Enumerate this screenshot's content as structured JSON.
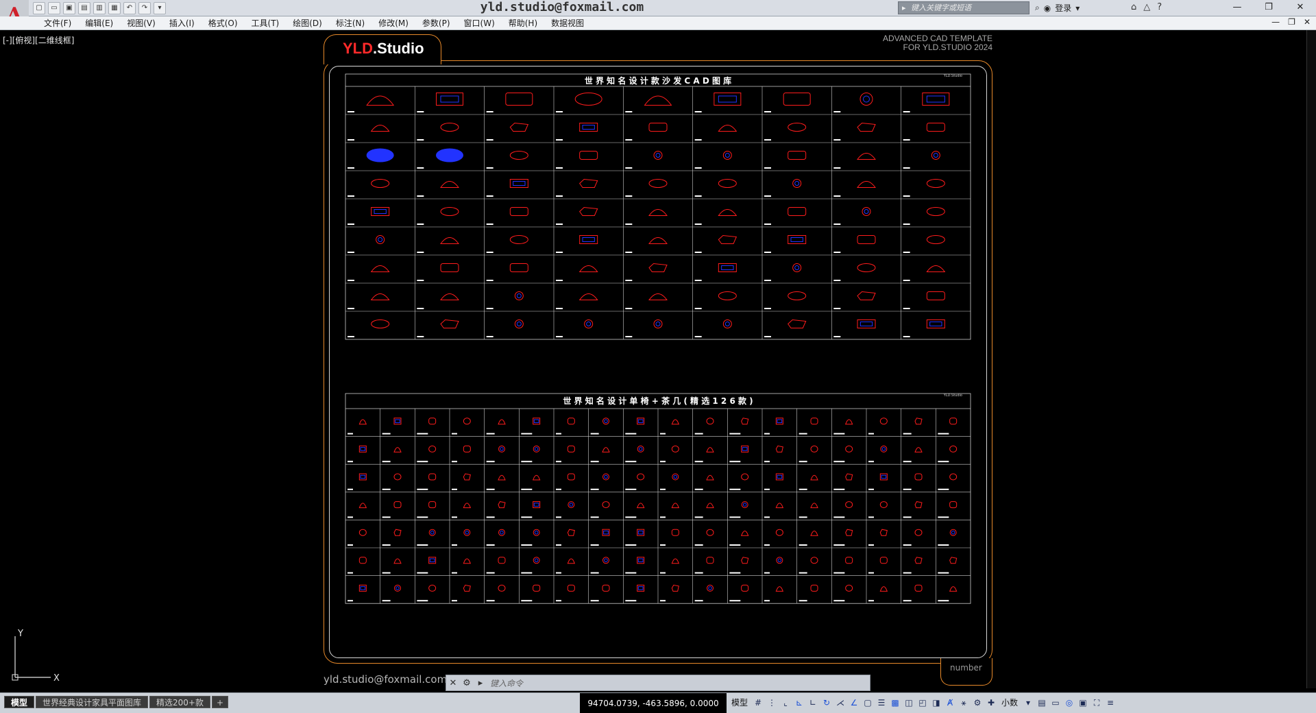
{
  "app": {
    "logo_letter": "A",
    "window_title": "yld.studio@foxmail.com",
    "search_placeholder": "键入关键字或短语",
    "login_label": "登录",
    "quick_access": [
      "new",
      "open",
      "save",
      "save-as",
      "plot-preview",
      "print",
      "undo",
      "redo"
    ]
  },
  "menu": [
    "文件(F)",
    "编辑(E)",
    "视图(V)",
    "插入(I)",
    "格式(O)",
    "工具(T)",
    "绘图(D)",
    "标注(N)",
    "修改(M)",
    "参数(P)",
    "窗口(W)",
    "帮助(H)",
    "数据视图"
  ],
  "viewport": {
    "label": "[-][俯视][二维线框]"
  },
  "drawing": {
    "brand_prefix": "YLD",
    "brand_suffix": ".Studio",
    "tagline_line1": "ADVANCED  CAD  TEMPLATE",
    "tagline_line2": "FOR YLD.STUDIO 2024",
    "section1_title": "世 界 知 名 设 计 款 沙 发 C A D 图 库",
    "section2_title": "世 界 知 名 设 计 单 椅 + 茶 几 ( 精 选 1 2 6 款 )",
    "corner_mark": "YLD.Studio",
    "number_label": "number",
    "email_label": "yld.studio@foxmail.com",
    "sofa_grid": {
      "rows": 9,
      "cols": 9
    },
    "chair_grid": {
      "rows": 7,
      "cols": 18
    },
    "colors": {
      "line_red": "#ff1c1c",
      "line_blue": "#2233ff",
      "border_orange": "#e88a2a",
      "grid_line": "#cfcfcf"
    }
  },
  "command_line": {
    "placeholder": "键入命令"
  },
  "ucs": {
    "x_label": "X",
    "y_label": "Y"
  },
  "status": {
    "layout_tabs": [
      "模型",
      "世界经典设计家具平面图库",
      "精选200+款"
    ],
    "add_tab": "+",
    "coordinates": "94704.0739, -463.5896, 0.0000",
    "model_label": "模型",
    "units_label": "小数"
  }
}
